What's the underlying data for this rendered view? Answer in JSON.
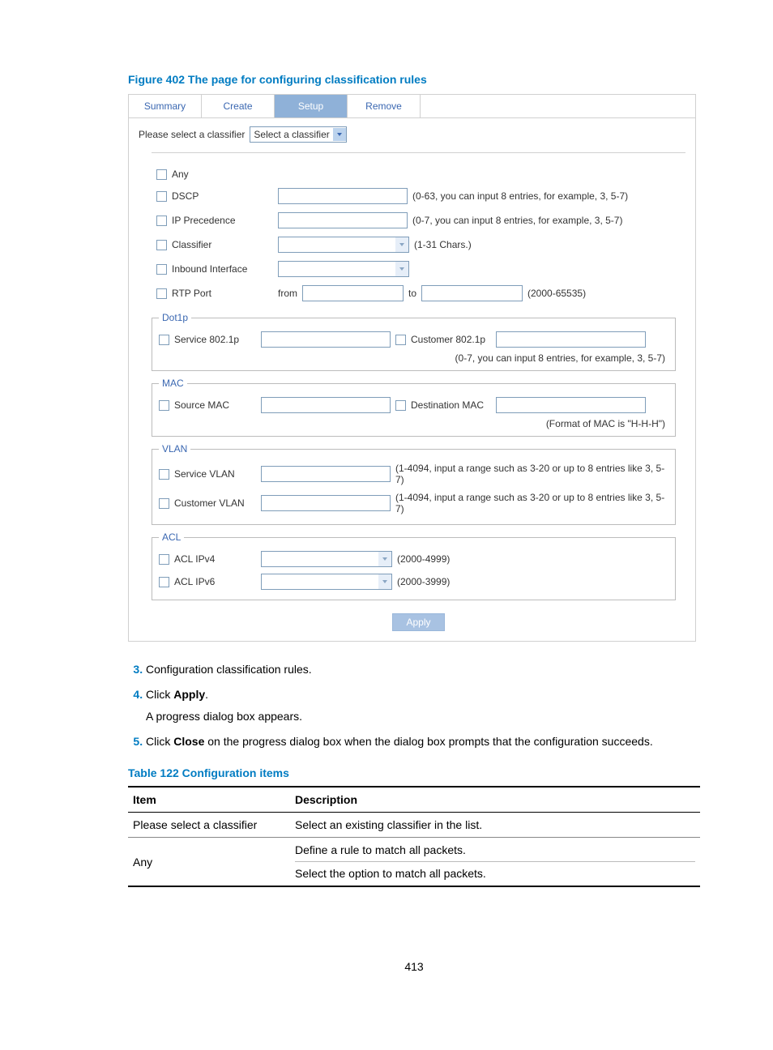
{
  "figure": {
    "title": "Figure 402 The page for configuring classification rules"
  },
  "tabs": {
    "summary": "Summary",
    "create": "Create",
    "setup": "Setup",
    "remove": "Remove"
  },
  "select_row": {
    "label": "Please select a classifier",
    "placeholder": "Select a classifier"
  },
  "rules": {
    "any": "Any",
    "dscp": {
      "label": "DSCP",
      "hint": "(0-63, you can input 8 entries, for example, 3, 5-7)"
    },
    "ipprec": {
      "label": "IP Precedence",
      "hint": "(0-7, you can input 8 entries, for example, 3, 5-7)"
    },
    "classifier": {
      "label": "Classifier",
      "hint": "(1-31 Chars.)"
    },
    "inbound": {
      "label": "Inbound Interface"
    },
    "rtp": {
      "label": "RTP Port",
      "from": "from",
      "to": "to",
      "hint": "(2000-65535)"
    }
  },
  "dot1p": {
    "legend": "Dot1p",
    "service": "Service 802.1p",
    "customer": "Customer 802.1p",
    "hint": "(0-7, you can input 8 entries, for example, 3, 5-7)"
  },
  "mac": {
    "legend": "MAC",
    "source": "Source MAC",
    "dest": "Destination MAC",
    "hint": "(Format of MAC is \"H-H-H\")"
  },
  "vlan": {
    "legend": "VLAN",
    "service": "Service VLAN",
    "customer": "Customer VLAN",
    "hint_service": "(1-4094, input a range such as 3-20 or up to 8 entries like 3, 5-7)",
    "hint_customer": "(1-4094, input a range such as 3-20 or up to 8 entries like 3, 5-7)"
  },
  "acl": {
    "legend": "ACL",
    "v4": "ACL IPv4",
    "v6": "ACL IPv6",
    "hint_v4": "(2000-4999)",
    "hint_v6": "(2000-3999)"
  },
  "apply": "Apply",
  "steps": {
    "s3": "Configuration classification rules.",
    "s4a": "Click ",
    "s4b": "Apply",
    "s4c": ".",
    "s4sub": "A progress dialog box appears.",
    "s5a": "Click ",
    "s5b": "Close",
    "s5c": " on the progress dialog box when the dialog box prompts that the configuration succeeds."
  },
  "table_title": "Table 122 Configuration items",
  "table": {
    "h_item": "Item",
    "h_desc": "Description",
    "r1_item": "Please select a classifier",
    "r1_desc": "Select an existing classifier in the list.",
    "r2_item": "Any",
    "r2_desc1": "Define a rule to match all packets.",
    "r2_desc2": "Select the option to match all packets."
  },
  "page_number": "413"
}
